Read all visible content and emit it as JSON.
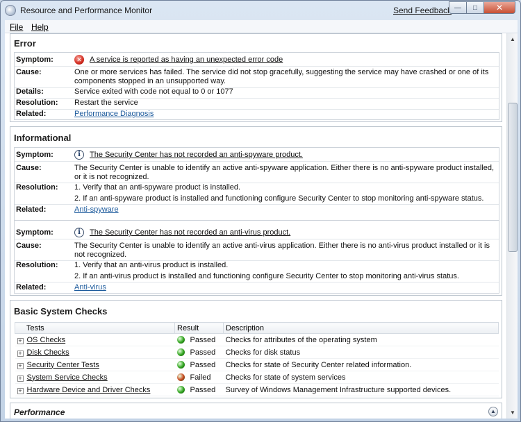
{
  "window": {
    "title": "Resource and Performance Monitor",
    "send_feedback": "Send Feedback",
    "controls": {
      "minimize": "—",
      "maximize": "□",
      "close": "✕"
    }
  },
  "menu": {
    "file": "File",
    "help": "Help"
  },
  "error": {
    "title": "Error",
    "symptom_label": "Symptom:",
    "symptom": "A service is reported as having an unexpected error code",
    "cause_label": "Cause:",
    "cause": "One or more services has failed. The service did not stop gracefully, suggesting the service may have crashed or one of its components stopped in an unsupported way.",
    "details_label": "Details:",
    "details": "Service exited with code not equal to 0 or 1077",
    "resolution_label": "Resolution:",
    "resolution": "Restart the service",
    "related_label": "Related:",
    "related": "Performance Diagnosis"
  },
  "informational": {
    "title": "Informational",
    "items": [
      {
        "symptom_label": "Symptom:",
        "symptom": "The Security Center has not recorded an anti-spyware product.",
        "cause_label": "Cause:",
        "cause": "The Security Center is unable to identify an active anti-spyware application. Either there is no anti-spyware product installed, or it is not recognized.",
        "resolution_label": "Resolution:",
        "resolution_1": "1. Verify that an anti-spyware product is installed.",
        "resolution_2": "2. If an anti-spyware product is installed and functioning configure Security Center to stop monitoring anti-spyware status.",
        "related_label": "Related:",
        "related": "Anti-spyware"
      },
      {
        "symptom_label": "Symptom:",
        "symptom": "The Security Center has not recorded an anti-virus product.",
        "cause_label": "Cause:",
        "cause": "The Security Center is unable to identify an active anti-virus application. Either there is no anti-virus product installed or it is not recognized.",
        "resolution_label": "Resolution:",
        "resolution_1": "1. Verify that an anti-virus product is installed.",
        "resolution_2": "2. If an anti-virus product is installed and functioning configure Security Center to stop monitoring anti-virus status.",
        "related_label": "Related:",
        "related": "Anti-virus"
      }
    ]
  },
  "checks": {
    "title": "Basic System Checks",
    "headers": {
      "tests": "Tests",
      "result": "Result",
      "description": "Description"
    },
    "rows": [
      {
        "test": "OS Checks",
        "result": "Passed",
        "status_color": "#2ea31c",
        "description": "Checks for attributes of the operating system"
      },
      {
        "test": "Disk Checks",
        "result": "Passed",
        "status_color": "#2ea31c",
        "description": "Checks for disk status"
      },
      {
        "test": "Security Center Tests",
        "result": "Passed",
        "status_color": "#2ea31c",
        "description": "Checks for state of Security Center related information."
      },
      {
        "test": "System Service Checks",
        "result": "Failed",
        "status_color": "#c8461c",
        "description": "Checks for state of system services"
      },
      {
        "test": "Hardware Device and Driver Checks",
        "result": "Passed",
        "status_color": "#2ea31c",
        "description": "Survey of Windows Management Infrastructure supported devices."
      }
    ]
  },
  "performance": {
    "title": "Performance"
  },
  "icons": {
    "error": "error-icon",
    "info": "info-icon",
    "expand": "plus-box-icon",
    "collapse": "chevron-up-circle-icon"
  }
}
